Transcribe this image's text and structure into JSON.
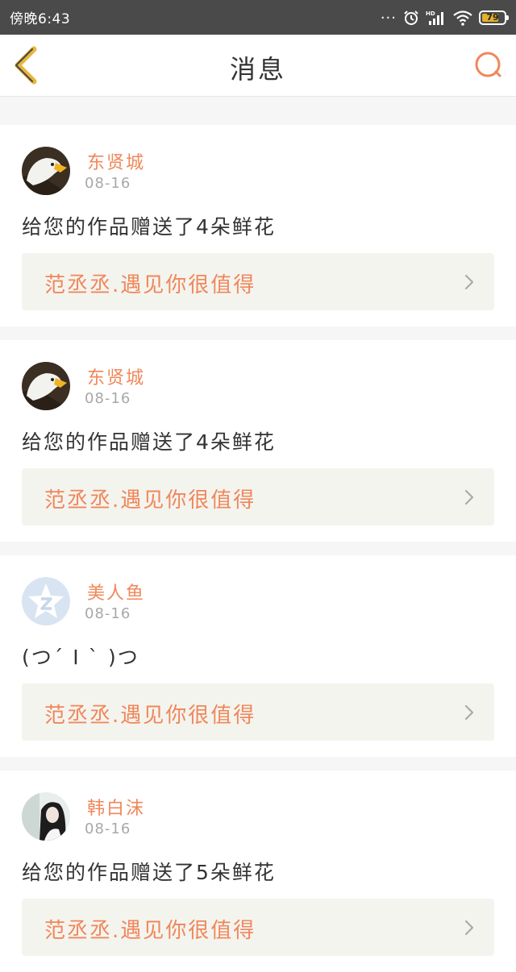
{
  "status_bar": {
    "time": "傍晚6:43",
    "dots": "...",
    "battery_level": "79",
    "battery_color": "#e3b02c"
  },
  "header": {
    "title": "消息",
    "accent_color": "#f0875a"
  },
  "messages": [
    {
      "name": "东贤城",
      "date": "08-16",
      "text": "给您的作品赠送了4朵鲜花",
      "work_title": "范丞丞.遇见你很值得",
      "avatar": "eagle"
    },
    {
      "name": "东贤城",
      "date": "08-16",
      "text": "给您的作品赠送了4朵鲜花",
      "work_title": "范丞丞.遇见你很值得",
      "avatar": "eagle"
    },
    {
      "name": "美人鱼",
      "date": "08-16",
      "text": "(つ´ Ι ` )つ",
      "work_title": "范丞丞.遇见你很值得",
      "avatar": "qq-default"
    },
    {
      "name": "韩白沫",
      "date": "08-16",
      "text": "给您的作品赠送了5朵鲜花",
      "work_title": "范丞丞.遇见你很值得",
      "avatar": "girl-photo"
    }
  ]
}
